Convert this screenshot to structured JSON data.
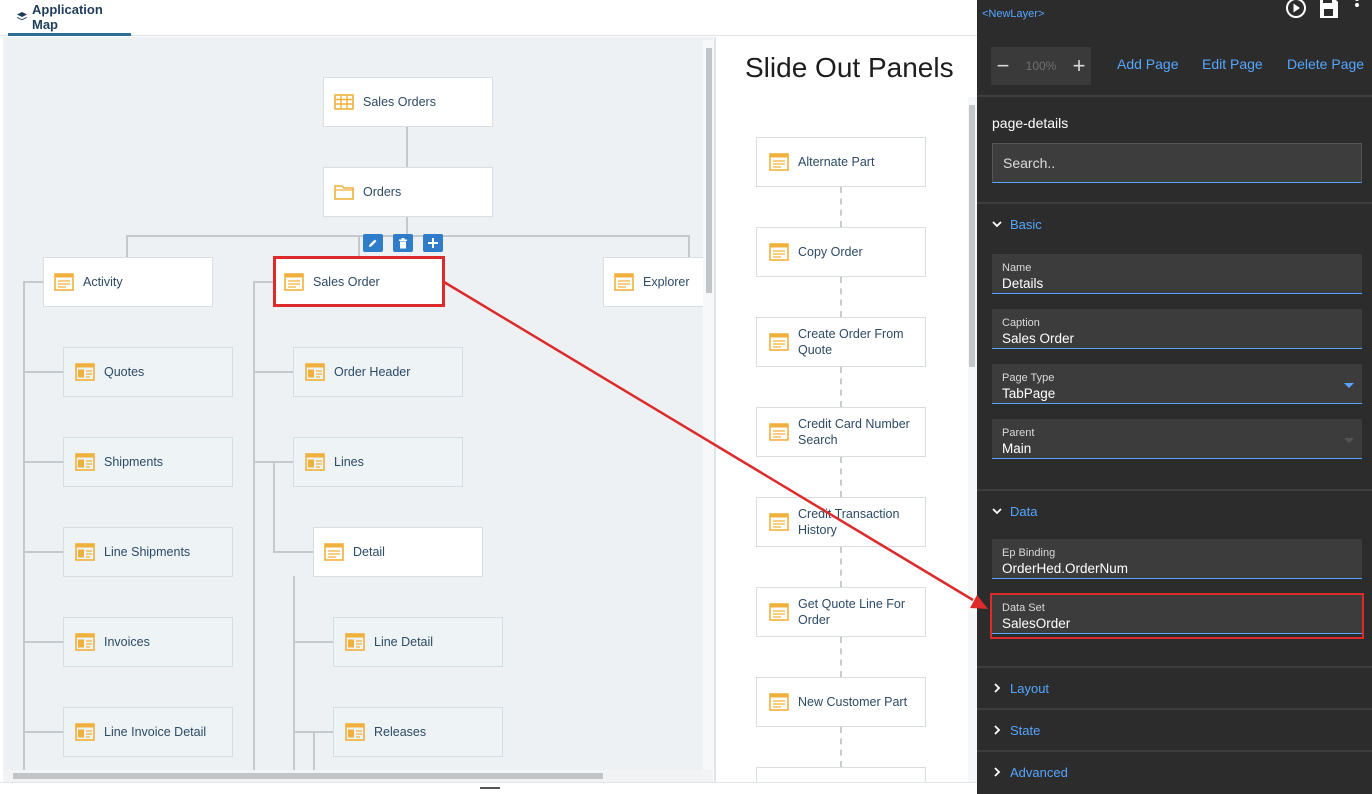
{
  "app_map": {
    "tab_label": "Application Map",
    "nodes": {
      "sales_orders": "Sales Orders",
      "orders": "Orders",
      "activity": "Activity",
      "sales_order": "Sales Order",
      "explorer": "Explorer",
      "quotes": "Quotes",
      "shipments": "Shipments",
      "line_shipments": "Line Shipments",
      "invoices": "Invoices",
      "line_invoice_detail": "Line Invoice Detail",
      "order_header": "Order Header",
      "lines": "Lines",
      "detail": "Detail",
      "line_detail": "Line Detail",
      "releases": "Releases"
    }
  },
  "slide_out": {
    "title": "Slide Out Panels",
    "items": [
      "Alternate Part",
      "Copy Order",
      "Create Order From Quote",
      "Credit Card Number Search",
      "Credit Transaction History",
      "Get Quote Line For Order",
      "New Customer Part"
    ]
  },
  "properties": {
    "layer_link": "<NewLayer>",
    "zoom": "100%",
    "zoom_minus": "−",
    "zoom_plus": "+",
    "add_page": "Add Page",
    "edit_page": "Edit Page",
    "delete_page": "Delete Page",
    "page_id": "page-details",
    "search_placeholder": "Search..",
    "sections": {
      "basic": "Basic",
      "data": "Data",
      "layout": "Layout",
      "state": "State",
      "advanced": "Advanced"
    },
    "fields": {
      "name": {
        "label": "Name",
        "value": "Details"
      },
      "caption": {
        "label": "Caption",
        "value": "Sales Order"
      },
      "page_type": {
        "label": "Page Type",
        "value": "TabPage"
      },
      "parent": {
        "label": "Parent",
        "value": "Main"
      },
      "ep_binding": {
        "label": "Ep Binding",
        "value": "OrderHed.OrderNum"
      },
      "data_set": {
        "label": "Data Set",
        "value": "SalesOrder"
      }
    }
  },
  "colors": {
    "accent_link": "#56a6ff",
    "highlight": "#dd2a2a",
    "panel_bg": "#2c2c2c",
    "icon_orange": "#f0b13c"
  }
}
